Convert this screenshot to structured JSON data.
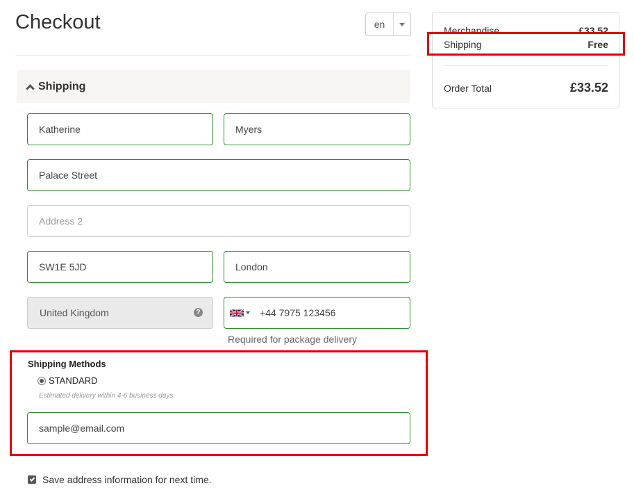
{
  "header": {
    "title": "Checkout",
    "language": "en"
  },
  "shipping_section": {
    "label": "Shipping",
    "first_name": "Katherine",
    "last_name": "Myers",
    "address1": "Palace Street",
    "address2_placeholder": "Address 2",
    "postcode": "SW1E 5JD",
    "city": "London",
    "country": "United Kingdom",
    "phone": "+44 7975 123456",
    "phone_hint": "Required for package delivery",
    "methods_title": "Shipping Methods",
    "method_label": "STANDARD",
    "method_note": "Estimated delivery within 4-6 business days.",
    "email": "sample@email.com",
    "save_label": "Save address information for next time."
  },
  "summary": {
    "merchandise_label": "Merchandise",
    "merchandise_value": "£33.52",
    "shipping_label": "Shipping",
    "shipping_value": "Free",
    "total_label": "Order Total",
    "total_value": "£33.52"
  },
  "colors": {
    "valid_border": "#2e8b2e",
    "highlight": "#e00000",
    "section_bg": "#f6f5f2"
  },
  "icons": {
    "collapse": "chevron-up-icon",
    "help": "question-circle-icon",
    "flag": "uk-flag-icon",
    "language_dropdown": "caret-down-icon"
  }
}
